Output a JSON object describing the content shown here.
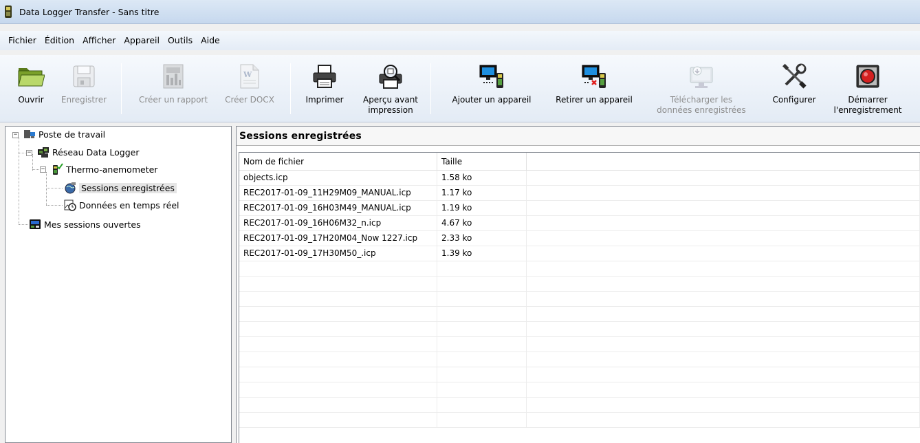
{
  "window": {
    "title": "Data Logger Transfer - Sans titre"
  },
  "menu": [
    "Fichier",
    "Édition",
    "Afficher",
    "Appareil",
    "Outils",
    "Aide"
  ],
  "toolbar": {
    "open": "Ouvrir",
    "save": "Enregistrer",
    "report": "Créer un rapport",
    "docx": "Créer DOCX",
    "print": "Imprimer",
    "preview": "Aperçu avant\nimpression",
    "add_device": "Ajouter un appareil",
    "remove_device": "Retirer un appareil",
    "download": "Télécharger les\ndonnées enregistrées",
    "configure": "Configurer",
    "start_recording": "Démarrer\nl'enregistrement"
  },
  "tree": {
    "workstation": "Poste de travail",
    "network": "Réseau Data Logger",
    "device": "Thermo-anemometer",
    "sessions": "Sessions enregistrées",
    "realtime": "Données en temps réel",
    "open_sessions": "Mes sessions ouvertes"
  },
  "panel": {
    "title": "Sessions enregistrées",
    "columns": [
      "Nom de fichier",
      "Taille"
    ],
    "rows": [
      [
        "objects.icp",
        "1.58 ko"
      ],
      [
        "REC2017-01-09_11H29M09_MANUAL.icp",
        "1.17 ko"
      ],
      [
        "REC2017-01-09_16H03M49_MANUAL.icp",
        "1.19 ko"
      ],
      [
        "REC2017-01-09_16H06M32_n.icp",
        "4.67 ko"
      ],
      [
        "REC2017-01-09_17H20M04_Now 1227.icp",
        "2.33 ko"
      ],
      [
        "REC2017-01-09_17H30M50_.icp",
        "1.39 ko"
      ]
    ]
  },
  "colors": {
    "titlebar": "#c6d8ee",
    "toolbar": "#e3ebf5",
    "selection": "#e5e5e5"
  }
}
